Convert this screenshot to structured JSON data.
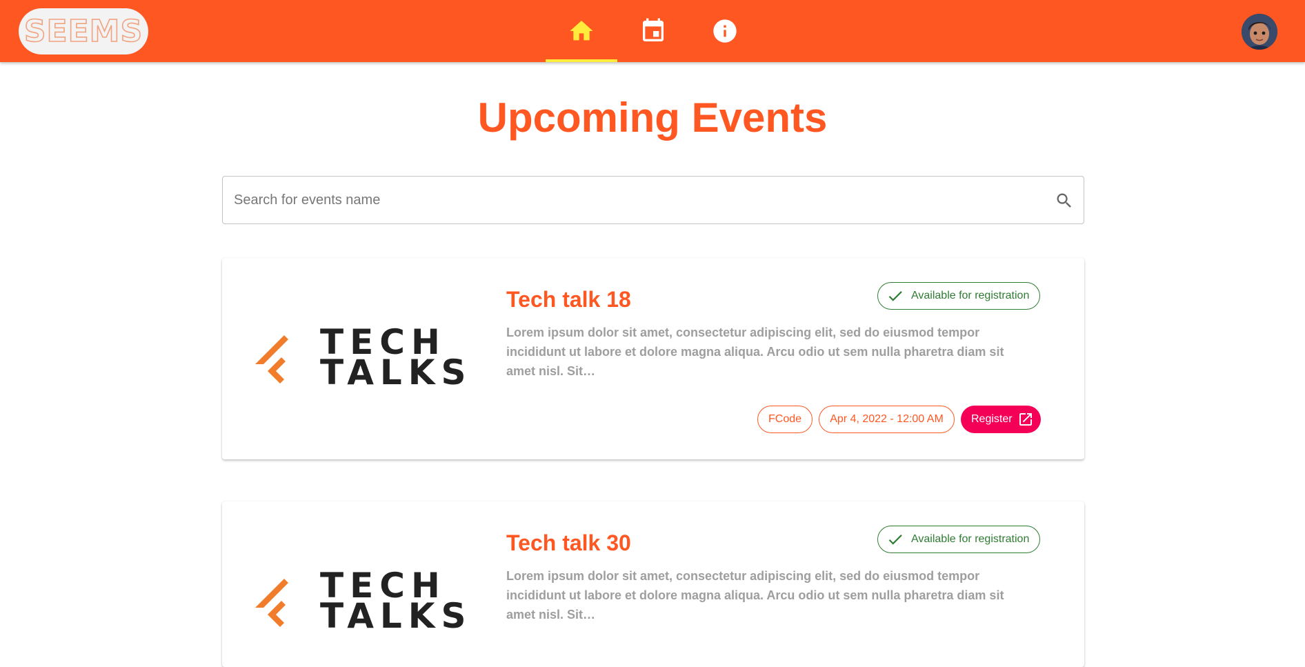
{
  "app": {
    "logo_text": "SEEMS",
    "nav": [
      {
        "icon": "home-icon",
        "active": true
      },
      {
        "icon": "calendar-icon",
        "active": false
      },
      {
        "icon": "info-icon",
        "active": false
      }
    ]
  },
  "page": {
    "title": "Upcoming Events",
    "search_placeholder": "Search for events name"
  },
  "events": [
    {
      "title": "Tech talk 18",
      "status": "Available for registration",
      "description": "Lorem ipsum dolor sit amet, consectetur adipiscing elit, sed do eiusmod tempor incididunt ut labore et dolore magna aliqua. Arcu odio ut sem nulla pharetra diam sit amet nisl. Sit…",
      "organizer": "FCode",
      "date": "Apr 4, 2022 - 12:00 AM",
      "register_label": "Register",
      "logo_text_line1": "TECH",
      "logo_text_line2": "TALKS"
    },
    {
      "title": "Tech talk 30",
      "status": "Available for registration",
      "description": "Lorem ipsum dolor sit amet, consectetur adipiscing elit, sed do eiusmod tempor incididunt ut labore et dolore magna aliqua. Arcu odio ut sem nulla pharetra diam sit amet nisl. Sit…",
      "logo_text_line1": "TECH",
      "logo_text_line2": "TALKS"
    }
  ],
  "colors": {
    "primary": "#ff5722",
    "active_indicator": "#ffeb3b",
    "success": "#2e7d32",
    "register": "#f50057",
    "logo_orange": "#f07c2c"
  }
}
